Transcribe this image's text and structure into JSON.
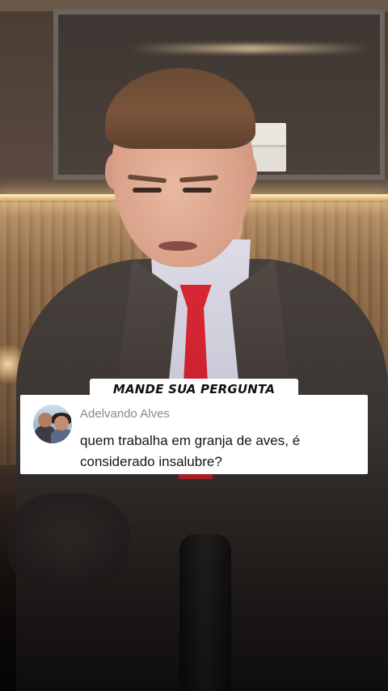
{
  "overlay": {
    "tag_label": "MANDE SUA PERGUNTA",
    "comment": {
      "author": "Adelvando Alves",
      "text": "quem trabalha em granja de aves, é considerado insalubre?"
    }
  },
  "colors": {
    "tie": "#d92633",
    "card_background": "#ffffff",
    "author_text": "#8a8a8a",
    "comment_text": "#161616"
  }
}
